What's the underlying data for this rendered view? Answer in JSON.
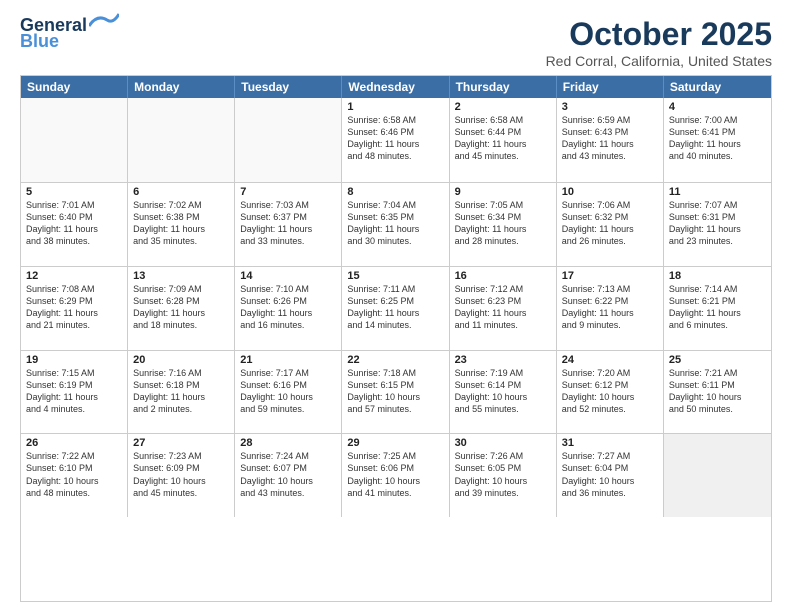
{
  "header": {
    "logo_line1": "General",
    "logo_line2": "Blue",
    "month_year": "October 2025",
    "location": "Red Corral, California, United States"
  },
  "weekdays": [
    "Sunday",
    "Monday",
    "Tuesday",
    "Wednesday",
    "Thursday",
    "Friday",
    "Saturday"
  ],
  "rows": [
    [
      {
        "day": "",
        "info": ""
      },
      {
        "day": "",
        "info": ""
      },
      {
        "day": "",
        "info": ""
      },
      {
        "day": "1",
        "info": "Sunrise: 6:58 AM\nSunset: 6:46 PM\nDaylight: 11 hours\nand 48 minutes."
      },
      {
        "day": "2",
        "info": "Sunrise: 6:58 AM\nSunset: 6:44 PM\nDaylight: 11 hours\nand 45 minutes."
      },
      {
        "day": "3",
        "info": "Sunrise: 6:59 AM\nSunset: 6:43 PM\nDaylight: 11 hours\nand 43 minutes."
      },
      {
        "day": "4",
        "info": "Sunrise: 7:00 AM\nSunset: 6:41 PM\nDaylight: 11 hours\nand 40 minutes."
      }
    ],
    [
      {
        "day": "5",
        "info": "Sunrise: 7:01 AM\nSunset: 6:40 PM\nDaylight: 11 hours\nand 38 minutes."
      },
      {
        "day": "6",
        "info": "Sunrise: 7:02 AM\nSunset: 6:38 PM\nDaylight: 11 hours\nand 35 minutes."
      },
      {
        "day": "7",
        "info": "Sunrise: 7:03 AM\nSunset: 6:37 PM\nDaylight: 11 hours\nand 33 minutes."
      },
      {
        "day": "8",
        "info": "Sunrise: 7:04 AM\nSunset: 6:35 PM\nDaylight: 11 hours\nand 30 minutes."
      },
      {
        "day": "9",
        "info": "Sunrise: 7:05 AM\nSunset: 6:34 PM\nDaylight: 11 hours\nand 28 minutes."
      },
      {
        "day": "10",
        "info": "Sunrise: 7:06 AM\nSunset: 6:32 PM\nDaylight: 11 hours\nand 26 minutes."
      },
      {
        "day": "11",
        "info": "Sunrise: 7:07 AM\nSunset: 6:31 PM\nDaylight: 11 hours\nand 23 minutes."
      }
    ],
    [
      {
        "day": "12",
        "info": "Sunrise: 7:08 AM\nSunset: 6:29 PM\nDaylight: 11 hours\nand 21 minutes."
      },
      {
        "day": "13",
        "info": "Sunrise: 7:09 AM\nSunset: 6:28 PM\nDaylight: 11 hours\nand 18 minutes."
      },
      {
        "day": "14",
        "info": "Sunrise: 7:10 AM\nSunset: 6:26 PM\nDaylight: 11 hours\nand 16 minutes."
      },
      {
        "day": "15",
        "info": "Sunrise: 7:11 AM\nSunset: 6:25 PM\nDaylight: 11 hours\nand 14 minutes."
      },
      {
        "day": "16",
        "info": "Sunrise: 7:12 AM\nSunset: 6:23 PM\nDaylight: 11 hours\nand 11 minutes."
      },
      {
        "day": "17",
        "info": "Sunrise: 7:13 AM\nSunset: 6:22 PM\nDaylight: 11 hours\nand 9 minutes."
      },
      {
        "day": "18",
        "info": "Sunrise: 7:14 AM\nSunset: 6:21 PM\nDaylight: 11 hours\nand 6 minutes."
      }
    ],
    [
      {
        "day": "19",
        "info": "Sunrise: 7:15 AM\nSunset: 6:19 PM\nDaylight: 11 hours\nand 4 minutes."
      },
      {
        "day": "20",
        "info": "Sunrise: 7:16 AM\nSunset: 6:18 PM\nDaylight: 11 hours\nand 2 minutes."
      },
      {
        "day": "21",
        "info": "Sunrise: 7:17 AM\nSunset: 6:16 PM\nDaylight: 10 hours\nand 59 minutes."
      },
      {
        "day": "22",
        "info": "Sunrise: 7:18 AM\nSunset: 6:15 PM\nDaylight: 10 hours\nand 57 minutes."
      },
      {
        "day": "23",
        "info": "Sunrise: 7:19 AM\nSunset: 6:14 PM\nDaylight: 10 hours\nand 55 minutes."
      },
      {
        "day": "24",
        "info": "Sunrise: 7:20 AM\nSunset: 6:12 PM\nDaylight: 10 hours\nand 52 minutes."
      },
      {
        "day": "25",
        "info": "Sunrise: 7:21 AM\nSunset: 6:11 PM\nDaylight: 10 hours\nand 50 minutes."
      }
    ],
    [
      {
        "day": "26",
        "info": "Sunrise: 7:22 AM\nSunset: 6:10 PM\nDaylight: 10 hours\nand 48 minutes."
      },
      {
        "day": "27",
        "info": "Sunrise: 7:23 AM\nSunset: 6:09 PM\nDaylight: 10 hours\nand 45 minutes."
      },
      {
        "day": "28",
        "info": "Sunrise: 7:24 AM\nSunset: 6:07 PM\nDaylight: 10 hours\nand 43 minutes."
      },
      {
        "day": "29",
        "info": "Sunrise: 7:25 AM\nSunset: 6:06 PM\nDaylight: 10 hours\nand 41 minutes."
      },
      {
        "day": "30",
        "info": "Sunrise: 7:26 AM\nSunset: 6:05 PM\nDaylight: 10 hours\nand 39 minutes."
      },
      {
        "day": "31",
        "info": "Sunrise: 7:27 AM\nSunset: 6:04 PM\nDaylight: 10 hours\nand 36 minutes."
      },
      {
        "day": "",
        "info": ""
      }
    ]
  ]
}
